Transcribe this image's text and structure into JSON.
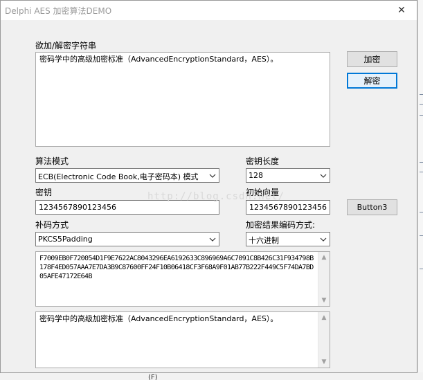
{
  "window": {
    "title": "Delphi AES 加密算法DEMO",
    "close_glyph": "✕"
  },
  "input_section": {
    "label": "欲加/解密字符串",
    "text": "密码学中的高级加密标准（AdvancedEncryptionStandard，AES）。"
  },
  "buttons": {
    "encrypt": "加密",
    "decrypt": "解密",
    "button3": "Button3"
  },
  "algorithm_mode": {
    "label": "算法模式",
    "value": "ECB(Electronic Code Book,电子密码本) 模式"
  },
  "key_length": {
    "label": "密钥长度",
    "value": "128"
  },
  "key": {
    "label": "密钥",
    "value": "1234567890123456"
  },
  "iv": {
    "label": "初始向量",
    "value": "1234567890123456"
  },
  "padding": {
    "label": "补码方式",
    "value": "PKCS5Padding"
  },
  "encoding": {
    "label": "加密结果编码方式:",
    "value": "十六进制"
  },
  "cipher_output": {
    "text": "F7009EB0F720054D1F9E7622AC8043296EA6192633C896969A6C7091C8B426C31F934798B178F4ED057AAA7E7DA3B9C87600FF24F10B06418CF3F68A9F01AB77B222F449C5F74DA7BD05AFE47172E64B"
  },
  "decrypt_output": {
    "text": "密码学中的高级加密标准（AdvancedEncryptionStandard，AES）。"
  },
  "watermark": "http://blog.csdn.net/",
  "background_partial_text": "(F)"
}
